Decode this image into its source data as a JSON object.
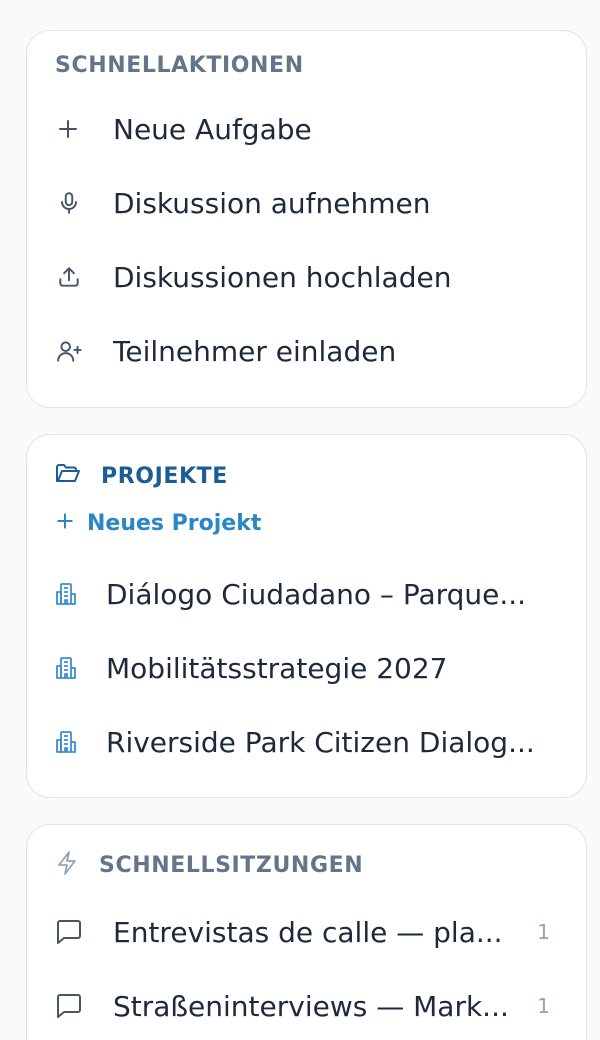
{
  "quick_actions": {
    "title": "SCHNELLAKTIONEN",
    "items": [
      {
        "label": "Neue Aufgabe",
        "icon": "plus-icon"
      },
      {
        "label": "Diskussion aufnehmen",
        "icon": "microphone-icon"
      },
      {
        "label": "Diskussionen hochladen",
        "icon": "upload-icon"
      },
      {
        "label": "Teilnehmer einladen",
        "icon": "user-plus-icon"
      }
    ]
  },
  "projects": {
    "title": "PROJEKTE",
    "title_icon": "folder-open-icon",
    "new_project_label": "Neues Projekt",
    "items": [
      {
        "label": "Diálogo Ciudadano – Parque...",
        "icon": "building-icon"
      },
      {
        "label": "Mobilitätsstrategie 2027",
        "icon": "building-icon"
      },
      {
        "label": "Riverside Park Citizen Dialog...",
        "icon": "building-icon"
      }
    ]
  },
  "quick_sessions": {
    "title": "SCHNELLSITZUNGEN",
    "title_icon": "zap-icon",
    "items": [
      {
        "label": "Entrevistas de calle — pla...",
        "count": "1",
        "icon": "message-square-icon"
      },
      {
        "label": "Straßeninterviews — Mark...",
        "count": "1",
        "icon": "message-square-icon"
      }
    ]
  },
  "colors": {
    "background": "#f8fafc",
    "card_border": "#dfe4ea",
    "text": "#1e293b",
    "muted": "#64748b",
    "project_title": "#1d5d96",
    "link": "#2b86c5",
    "building_icon": "#3b8fd0"
  }
}
